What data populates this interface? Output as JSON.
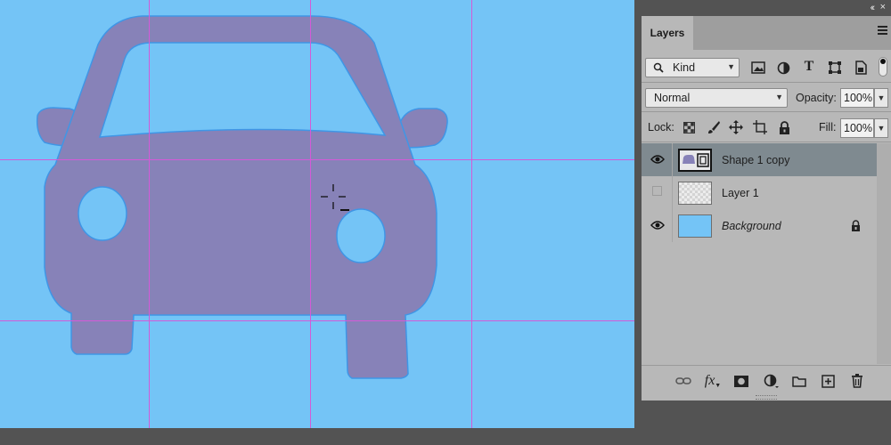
{
  "panel": {
    "collapse_glyph": "‹‹",
    "close_glyph": "×",
    "tab_label": "Layers",
    "filter_kind": "Kind",
    "blend_mode": "Normal",
    "opacity_label": "Opacity:",
    "opacity_value": "100%",
    "lock_label": "Lock:",
    "fill_label": "Fill:",
    "fill_value": "100%"
  },
  "layers": [
    {
      "name": "Shape 1 copy",
      "visible": true,
      "selected": true,
      "italic": false
    },
    {
      "name": "Layer 1",
      "visible": false,
      "selected": false,
      "italic": false
    },
    {
      "name": "Background",
      "visible": true,
      "selected": false,
      "italic": true,
      "locked": true
    }
  ],
  "colors": {
    "canvas_bg": "#74c4f6",
    "shape_fill": "#8782b8",
    "shape_stroke": "#3f96e6",
    "guide": "#d45ad8",
    "panel_bg": "#b8b8b8",
    "selected_row": "#7f8a90"
  },
  "icons": [
    "search-icon",
    "image-filter-icon",
    "adjustment-filter-icon",
    "type-filter-icon",
    "shape-filter-icon",
    "smart-object-filter-icon",
    "lock-transparent-icon",
    "lock-pixels-icon",
    "lock-position-icon",
    "lock-artboard-icon",
    "lock-all-icon",
    "eye-icon",
    "link-icon",
    "fx-icon",
    "mask-icon",
    "adjustment-layer-icon",
    "group-folder-icon",
    "new-layer-icon",
    "trash-icon",
    "crosshair-cursor-icon"
  ]
}
